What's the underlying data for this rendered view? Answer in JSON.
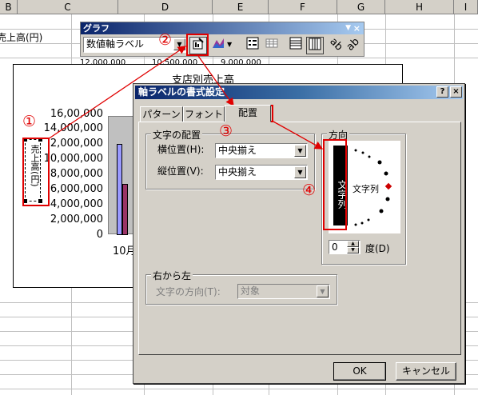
{
  "spreadsheet": {
    "columns": [
      "B",
      "C",
      "D",
      "E",
      "F",
      "G",
      "H",
      "I"
    ],
    "cells": {
      "b_label": "売上高(円)",
      "row_partial": "12,000,000",
      "d_partial": "10,500,000",
      "e_partial": "9,000,000",
      "chart_title_partial": "支店別売上高"
    }
  },
  "chart": {
    "y_ticks": [
      "16,00,000",
      "14,000,000",
      "2,000,000",
      "10,000,000",
      "8,000,000",
      "6,000,000",
      "4,000,000",
      "2,000,000",
      "0"
    ],
    "x_label_partial": "10月",
    "axis_title": "売上高(円)"
  },
  "toolbar": {
    "title": "グラフ",
    "object_select": "数値軸ラベル"
  },
  "dialog": {
    "title": "軸ラベルの書式設定",
    "help_btn": "?",
    "close_btn": "×",
    "tabs": [
      "パターン",
      "フォント",
      "配置"
    ],
    "text_alignment_group": "文字の配置",
    "horizontal_label": "横位置(H):",
    "horizontal_value": "中央揃え",
    "vertical_label": "縦位置(V):",
    "vertical_value": "中央揃え",
    "orientation_group": "方向",
    "vertical_text": "文字列",
    "angled_text": "文字列",
    "degrees_value": "0",
    "degrees_label": "度(D)",
    "rtl_group": "右から左",
    "text_direction_label": "文字の方向(T):",
    "text_direction_value": "対象",
    "ok": "OK",
    "cancel": "キャンセル"
  },
  "annotations": [
    "①",
    "②",
    "③",
    "④"
  ],
  "colors": {
    "annotation": "#e00000",
    "bar_blue": "#9999ff",
    "bar_maroon": "#993366"
  }
}
